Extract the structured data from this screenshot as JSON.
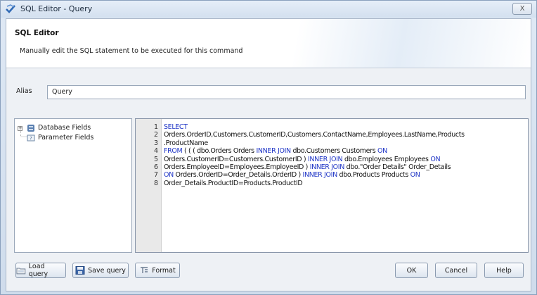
{
  "window": {
    "title": "SQL Editor - Query",
    "close_label": "X"
  },
  "header": {
    "title": "SQL Editor",
    "description": "Manually edit the SQL statement to be executed for this command"
  },
  "alias": {
    "label": "Alias",
    "value": "Query"
  },
  "tree": {
    "items": [
      {
        "label": "Database Fields",
        "expander": "+"
      },
      {
        "label": "Parameter Fields"
      }
    ]
  },
  "editor": {
    "line_numbers": [
      "1",
      "2",
      "3",
      "4",
      "5",
      "6",
      "7",
      "8"
    ],
    "lines": [
      [
        {
          "t": "SELECT",
          "kw": true
        }
      ],
      [
        {
          "t": "Orders.OrderID,Customers.CustomerID,Customers.ContactName,Employees.LastName,Products"
        }
      ],
      [
        {
          "t": ".ProductName"
        }
      ],
      [
        {
          "t": "FROM",
          "kw": true
        },
        {
          "t": " ( ( ( dbo.Orders Orders "
        },
        {
          "t": "INNER JOIN",
          "kw": true
        },
        {
          "t": " dbo.Customers Customers "
        },
        {
          "t": "ON",
          "kw": true
        }
      ],
      [
        {
          "t": "Orders.CustomerID=Customers.CustomerID ) "
        },
        {
          "t": "INNER JOIN",
          "kw": true
        },
        {
          "t": " dbo.Employees Employees "
        },
        {
          "t": "ON",
          "kw": true
        }
      ],
      [
        {
          "t": "Orders.EmployeeID=Employees.EmployeeID ) "
        },
        {
          "t": "INNER JOIN",
          "kw": true
        },
        {
          "t": " dbo.\"Order Details\" Order_Details"
        }
      ],
      [
        {
          "t": "ON",
          "kw": true
        },
        {
          "t": " Orders.OrderID=Order_Details.OrderID ) "
        },
        {
          "t": "INNER JOIN",
          "kw": true
        },
        {
          "t": " dbo.Products Products "
        },
        {
          "t": "ON",
          "kw": true
        }
      ],
      [
        {
          "t": "Order_Details.ProductID=Products.ProductID"
        }
      ]
    ]
  },
  "buttons": {
    "load_query": "Load query",
    "save_query": "Save query",
    "format": "Format",
    "ok": "OK",
    "cancel": "Cancel",
    "help": "Help"
  },
  "colors": {
    "keyword": "#1f35c6",
    "gutter": "#e9e9e9"
  },
  "icons": {
    "app": "sql-editor-icon",
    "database_fields": "database-icon",
    "parameter_fields": "parameter-icon",
    "load": "folder-icon",
    "save": "floppy-icon",
    "format": "format-icon"
  }
}
